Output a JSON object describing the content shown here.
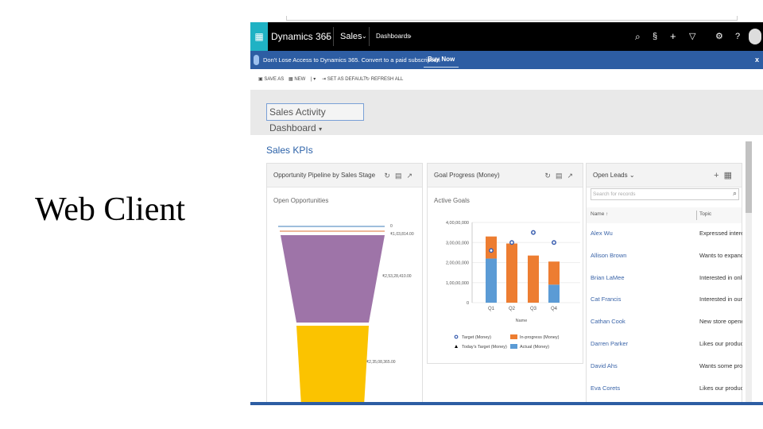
{
  "slide_title": "Web Client",
  "nav": {
    "app": "Dynamics 365",
    "module": "Sales",
    "breadcrumb": "Dashboards",
    "chevron": "⌄",
    "bc_sep": "›",
    "icons": [
      "search-icon",
      "assistant-icon",
      "plus-icon",
      "filter-icon",
      "gear-icon",
      "help-icon",
      "avatar"
    ]
  },
  "banner": {
    "message": "Don't Lose Access to Dynamics 365. Convert to a paid subscription",
    "button": "Buy Now",
    "close": "x"
  },
  "commands": {
    "save_as": "SAVE AS",
    "new": "NEW",
    "set_default": "SET AS DEFAULT",
    "refresh": "REFRESH ALL"
  },
  "dashboard_select": "Sales Activity Dashboard",
  "section_title": "Sales KPIs",
  "pipeline": {
    "title": "Opportunity Pipeline by Sales Stage",
    "subtitle": "Open Opportunities",
    "labels": [
      "0",
      "₹1,03,814.00",
      "₹2,53,28,410.00",
      "₹2,35,08,365.00"
    ],
    "colors": [
      "#7fa8d0",
      "#e8a17a",
      "#9e74a8",
      "#fbc300"
    ]
  },
  "chart_data": {
    "type": "bar",
    "title": "Goal Progress (Money)",
    "subtitle": "Active Goals",
    "categories": [
      "Q1",
      "Q2",
      "Q3",
      "Q4"
    ],
    "xlabel": "Name",
    "ylim": [
      0,
      40000000
    ],
    "yticks": [
      "0",
      "1,00,00,000",
      "2,00,00,000",
      "3,00,00,000",
      "4,00,00,000"
    ],
    "series": [
      {
        "name": "Actual (Money)",
        "color": "#5b9bd5",
        "values": [
          22000000,
          0,
          0,
          9000000
        ]
      },
      {
        "name": "In-progress (Money)",
        "color": "#ed7d31",
        "values": [
          11000000,
          29500000,
          23500000,
          11500000
        ]
      },
      {
        "name": "Target (Money)",
        "color": "#3b5fb0",
        "values": [
          26000000,
          30000000,
          35000000,
          30000000
        ]
      }
    ],
    "legend": [
      "Target (Money)",
      "In-progress (Money)",
      "Today's Target (Money)",
      "Actual (Money)"
    ]
  },
  "leads": {
    "title": "Open Leads",
    "search_placeholder": "Search for records",
    "col_name": "Name ↑",
    "col_topic": "Topic",
    "rows": [
      {
        "name": "Alex Wu",
        "topic": "Expressed interest i"
      },
      {
        "name": "Allison Brown",
        "topic": "Wants to expand"
      },
      {
        "name": "Brian LaMee",
        "topic": "Interested in online"
      },
      {
        "name": "Cat Francis",
        "topic": "Interested in our ne"
      },
      {
        "name": "Cathan Cook",
        "topic": "New store opened"
      },
      {
        "name": "Darren Parker",
        "topic": "Likes our products"
      },
      {
        "name": "David Ahs",
        "topic": "Wants some produ"
      },
      {
        "name": "Eva Corets",
        "topic": "Likes our products"
      }
    ]
  }
}
